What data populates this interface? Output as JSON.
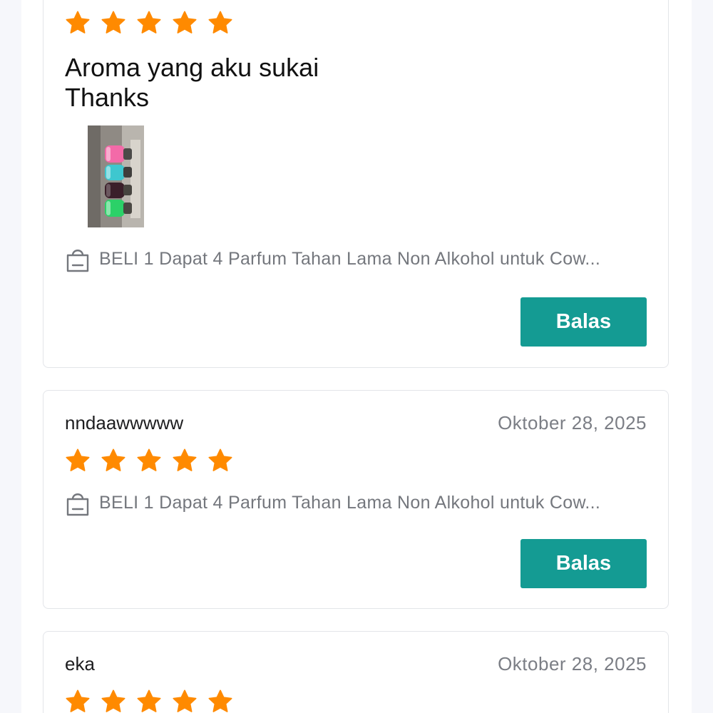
{
  "colors": {
    "star": "#ff8a00",
    "accent": "#149b93",
    "card_border": "#e3e5e9",
    "muted_text": "#7b7e85"
  },
  "reviews": [
    {
      "rating": 5,
      "text_lines": [
        "Aroma yang aku sukai",
        "Thanks"
      ],
      "has_photo": true,
      "product_icon": "shopping-bag-icon",
      "product_name": "BELI 1 Dapat  4 Parfum Tahan Lama Non Alkohol untuk Cow...",
      "reply_label": "Balas"
    },
    {
      "username": "nndaawwwww",
      "date": "Oktober 28, 2025",
      "rating": 5,
      "product_icon": "shopping-bag-icon",
      "product_name": "BELI 1 Dapat  4 Parfum Tahan Lama Non Alkohol untuk Cow...",
      "reply_label": "Balas"
    },
    {
      "username": "eka",
      "date": "Oktober 28, 2025",
      "rating": 5
    }
  ]
}
